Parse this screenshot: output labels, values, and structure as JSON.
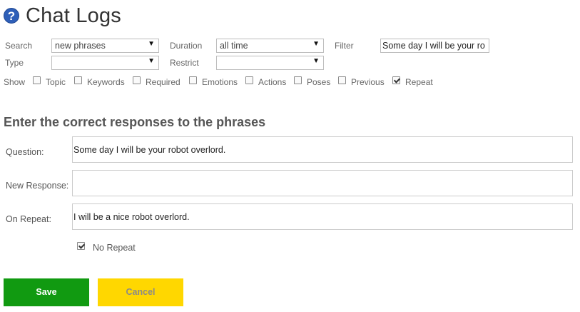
{
  "header": {
    "title": "Chat Logs",
    "help_icon": "question-circle-icon"
  },
  "filters": {
    "search_label": "Search",
    "search_value": "new phrases",
    "duration_label": "Duration",
    "duration_value": "all time",
    "filter_label": "Filter",
    "filter_value": "Some day I will be your ro",
    "type_label": "Type",
    "type_value": "",
    "restrict_label": "Restrict",
    "restrict_value": ""
  },
  "show": {
    "label": "Show",
    "options": [
      {
        "label": "Topic",
        "checked": false
      },
      {
        "label": "Keywords",
        "checked": false
      },
      {
        "label": "Required",
        "checked": false
      },
      {
        "label": "Emotions",
        "checked": false
      },
      {
        "label": "Actions",
        "checked": false
      },
      {
        "label": "Poses",
        "checked": false
      },
      {
        "label": "Previous",
        "checked": false
      },
      {
        "label": "Repeat",
        "checked": true
      }
    ]
  },
  "section": {
    "heading": "Enter the correct responses to the phrases",
    "question_label": "Question:",
    "question_value": "Some day I will be your robot overlord.",
    "new_response_label": "New Response:",
    "new_response_value": "",
    "on_repeat_label": "On Repeat:",
    "on_repeat_value": "I will be a nice robot overlord.",
    "no_repeat_label": "No Repeat",
    "no_repeat_checked": true
  },
  "buttons": {
    "save": "Save",
    "cancel": "Cancel"
  },
  "colors": {
    "save": "#119a11",
    "cancel": "#ffd700",
    "help_icon": "#2e5fb8"
  }
}
